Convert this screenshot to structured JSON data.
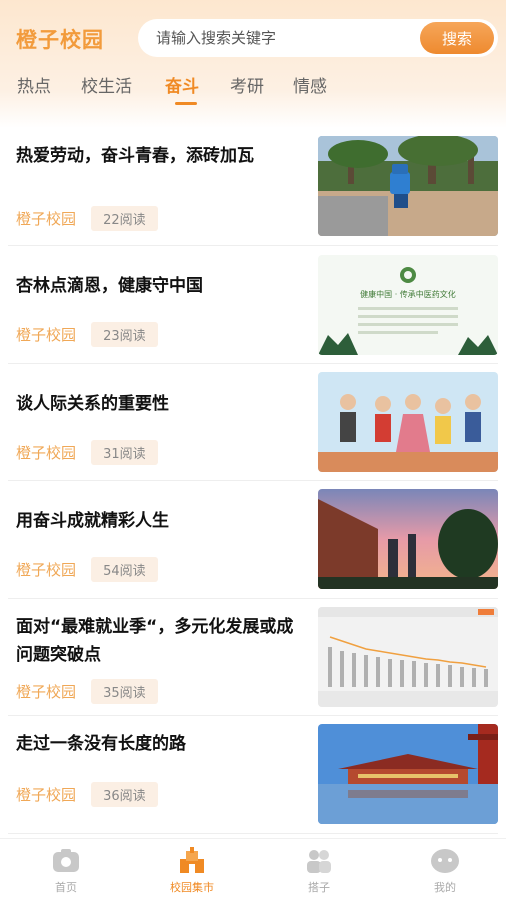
{
  "header": {
    "brand": "橙子校园",
    "search_placeholder": "请输入搜索关键字",
    "search_button": "搜索"
  },
  "tabs": [
    {
      "label": "热点"
    },
    {
      "label": "校生活"
    },
    {
      "label": "奋斗"
    },
    {
      "label": "考研"
    },
    {
      "label": "情感"
    }
  ],
  "articles": [
    {
      "title": "热爱劳动，奋斗青春，添砖加瓦",
      "author": "橙子校园",
      "reads": "22阅读"
    },
    {
      "title": "杏林点滴恩，健康守中国",
      "author": "橙子校园",
      "reads": "23阅读",
      "image_caption": "健康中国 · 传承中医药文化"
    },
    {
      "title": "谈人际关系的重要性",
      "author": "橙子校园",
      "reads": "31阅读"
    },
    {
      "title": "用奋斗成就精彩人生",
      "author": "橙子校园",
      "reads": "54阅读"
    },
    {
      "title": "面对“最难就业季“，多元化发展或成问题突破点",
      "author": "橙子校园",
      "reads": "35阅读"
    },
    {
      "title": "走过一条没有长度的路",
      "author": "橙子校园",
      "reads": "36阅读"
    }
  ],
  "bottom_nav": [
    {
      "label": "首页",
      "icon": "home-icon"
    },
    {
      "label": "校园集市",
      "icon": "market-icon"
    },
    {
      "label": "搭子",
      "icon": "partner-icon"
    },
    {
      "label": "我的",
      "icon": "profile-icon"
    }
  ],
  "colors": {
    "accent": "#f08a24",
    "brand": "#f29b3c",
    "header_bg": "#fde7cf"
  }
}
